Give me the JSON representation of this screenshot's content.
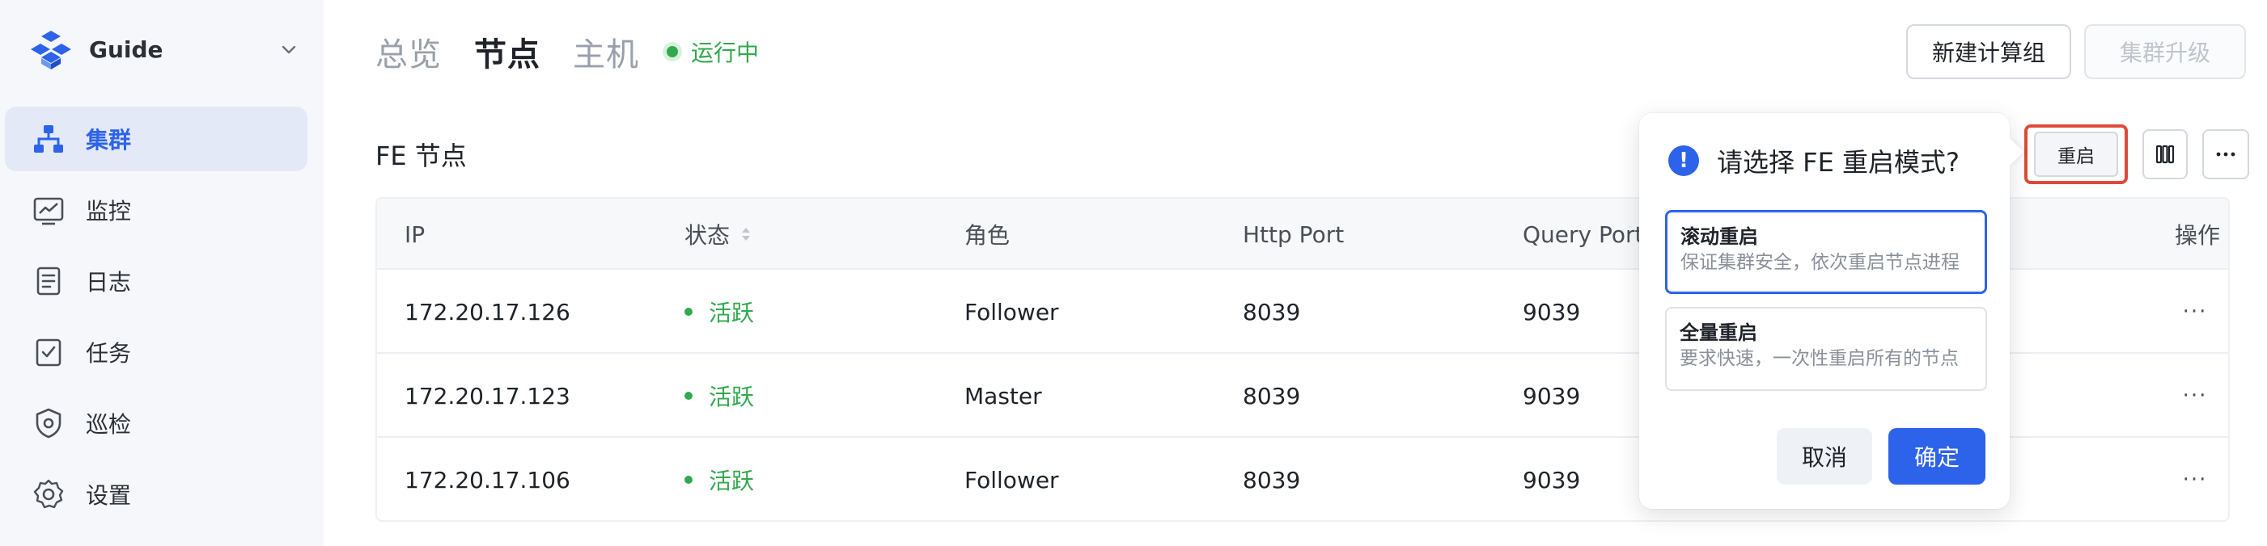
{
  "sidebar": {
    "workspace_name": "Guide",
    "items": [
      {
        "label": "集群",
        "icon": "cluster-icon",
        "active": true
      },
      {
        "label": "监控",
        "icon": "monitor-icon",
        "active": false
      },
      {
        "label": "日志",
        "icon": "log-icon",
        "active": false
      },
      {
        "label": "任务",
        "icon": "task-icon",
        "active": false
      },
      {
        "label": "巡检",
        "icon": "inspection-icon",
        "active": false
      },
      {
        "label": "设置",
        "icon": "settings-icon",
        "active": false
      }
    ]
  },
  "header": {
    "tabs": [
      {
        "label": "总览",
        "active": false
      },
      {
        "label": "节点",
        "active": true
      },
      {
        "label": "主机",
        "active": false
      }
    ],
    "status": "运行中",
    "new_compute_group": "新建计算组",
    "cluster_upgrade": "集群升级"
  },
  "section": {
    "title": "FE 节点",
    "restart_button": "重启",
    "columns_icon": "columns-icon",
    "more_icon": "more-icon"
  },
  "table": {
    "headers": [
      "IP",
      "状态",
      "角色",
      "Http Port",
      "Query Port",
      "操作"
    ],
    "rows": [
      {
        "ip": "172.20.17.126",
        "status": "活跃",
        "role": "Follower",
        "http_port": "8039",
        "query_port": "9039",
        "action": "···"
      },
      {
        "ip": "172.20.17.123",
        "status": "活跃",
        "role": "Master",
        "http_port": "8039",
        "query_port": "9039",
        "action": "···"
      },
      {
        "ip": "172.20.17.106",
        "status": "活跃",
        "role": "Follower",
        "http_port": "8039",
        "query_port": "9039",
        "action": "···"
      }
    ]
  },
  "popover": {
    "title": "请选择 FE 重启模式?",
    "options": [
      {
        "title": "滚动重启",
        "desc": "保证集群安全，依次重启节点进程",
        "selected": true
      },
      {
        "title": "全量重启",
        "desc": "要求快速，一次性重启所有的节点",
        "selected": false
      }
    ],
    "cancel": "取消",
    "confirm": "确定"
  },
  "colors": {
    "accent": "#2d63ea",
    "success": "#32a94e",
    "highlight_border": "#de4a3a"
  }
}
